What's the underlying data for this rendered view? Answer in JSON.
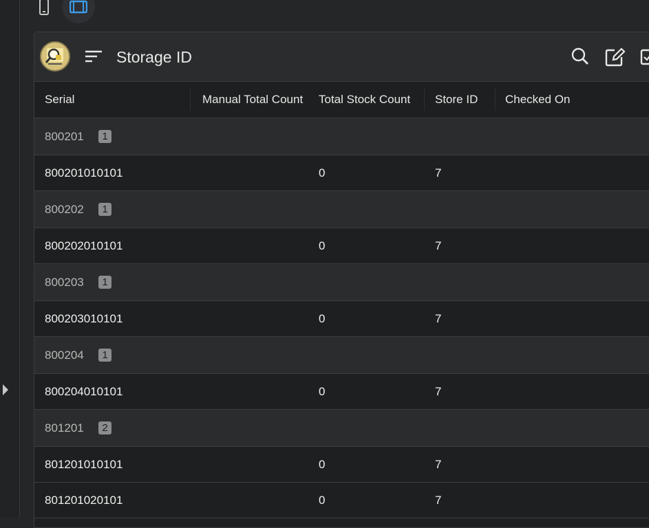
{
  "toolbar": {
    "title": "Storage ID"
  },
  "table": {
    "columns": [
      "Serial",
      "Manual Total Count",
      "Total Stock Count",
      "Store ID",
      "Checked On"
    ],
    "groups": [
      {
        "label": "800201",
        "count": "1",
        "rows": [
          {
            "serial": "800201010101",
            "manual": "",
            "total": "0",
            "store": "7",
            "checked": ""
          }
        ]
      },
      {
        "label": "800202",
        "count": "1",
        "rows": [
          {
            "serial": "800202010101",
            "manual": "",
            "total": "0",
            "store": "7",
            "checked": ""
          }
        ]
      },
      {
        "label": "800203",
        "count": "1",
        "rows": [
          {
            "serial": "800203010101",
            "manual": "",
            "total": "0",
            "store": "7",
            "checked": ""
          }
        ]
      },
      {
        "label": "800204",
        "count": "1",
        "rows": [
          {
            "serial": "800204010101",
            "manual": "",
            "total": "0",
            "store": "7",
            "checked": ""
          }
        ]
      },
      {
        "label": "801201",
        "count": "2",
        "rows": [
          {
            "serial": "801201010101",
            "manual": "",
            "total": "0",
            "store": "7",
            "checked": ""
          },
          {
            "serial": "801201020101",
            "manual": "",
            "total": "0",
            "store": "7",
            "checked": ""
          }
        ]
      }
    ]
  },
  "colors": {
    "accent": "#3d9be9",
    "background": "#252627",
    "group_row": "#2b2c2d",
    "data_row": "#1e1f20"
  }
}
